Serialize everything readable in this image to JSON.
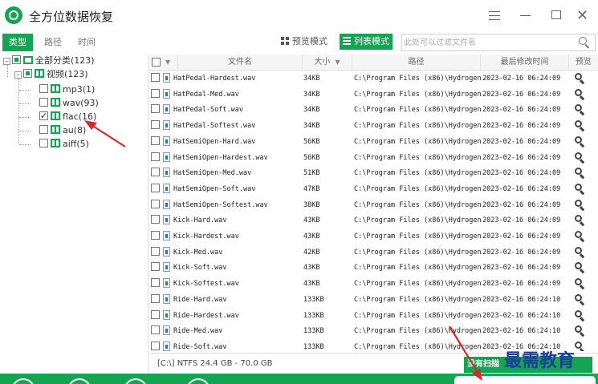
{
  "app": {
    "title": "全方位数据恢复"
  },
  "tabs": [
    {
      "label": "类型",
      "active": true
    },
    {
      "label": "路径",
      "active": false
    },
    {
      "label": "时间",
      "active": false
    }
  ],
  "view": {
    "preview_label": "预览模式",
    "list_label": "列表模式"
  },
  "search": {
    "placeholder": "此处可以过滤文件名"
  },
  "tree": {
    "root": "全部分类(123)",
    "child": "视频(123)",
    "items": [
      {
        "label": "mp3(1)",
        "checked": false
      },
      {
        "label": "wav(93)",
        "checked": false
      },
      {
        "label": "flac(16)",
        "checked": true
      },
      {
        "label": "au(8)",
        "checked": false
      },
      {
        "label": "aiff(5)",
        "checked": false
      }
    ]
  },
  "table": {
    "headers": {
      "name": "文件名",
      "size": "大小",
      "path": "路径",
      "modified": "最后修改时间",
      "preview": "预览"
    },
    "rows": [
      {
        "name": "HatPedal-Hardest.wav",
        "size": "34KB",
        "path": "C:\\Program Files (x86)\\Hydrogen",
        "date": "2023-02-16 06:24:09"
      },
      {
        "name": "HatPedal-Med.wav",
        "size": "34KB",
        "path": "C:\\Program Files (x86)\\Hydrogen",
        "date": "2023-02-16 06:24:09"
      },
      {
        "name": "HatPedal-Soft.wav",
        "size": "34KB",
        "path": "C:\\Program Files (x86)\\Hydrogen",
        "date": "2023-02-16 06:24:09"
      },
      {
        "name": "HatPedal-Softest.wav",
        "size": "34KB",
        "path": "C:\\Program Files (x86)\\Hydrogen",
        "date": "2023-02-16 06:24:09"
      },
      {
        "name": "HatSemiOpen-Hard.wav",
        "size": "56KB",
        "path": "C:\\Program Files (x86)\\Hydrogen",
        "date": "2023-02-16 06:24:09"
      },
      {
        "name": "HatSemiOpen-Hardest.wav",
        "size": "56KB",
        "path": "C:\\Program Files (x86)\\Hydrogen",
        "date": "2023-02-16 06:24:09"
      },
      {
        "name": "HatSemiOpen-Med.wav",
        "size": "51KB",
        "path": "C:\\Program Files (x86)\\Hydrogen",
        "date": "2023-02-16 06:24:09"
      },
      {
        "name": "HatSemiOpen-Soft.wav",
        "size": "47KB",
        "path": "C:\\Program Files (x86)\\Hydrogen",
        "date": "2023-02-16 06:24:09"
      },
      {
        "name": "HatSemiOpen-Softest.wav",
        "size": "38KB",
        "path": "C:\\Program Files (x86)\\Hydrogen",
        "date": "2023-02-16 06:24:09"
      },
      {
        "name": "Kick-Hard.wav",
        "size": "43KB",
        "path": "C:\\Program Files (x86)\\Hydrogen",
        "date": "2023-02-16 06:24:09"
      },
      {
        "name": "Kick-Hardest.wav",
        "size": "43KB",
        "path": "C:\\Program Files (x86)\\Hydrogen",
        "date": "2023-02-16 06:24:09"
      },
      {
        "name": "Kick-Med.wav",
        "size": "42KB",
        "path": "C:\\Program Files (x86)\\Hydrogen",
        "date": "2023-02-16 06:24:09"
      },
      {
        "name": "Kick-Soft.wav",
        "size": "43KB",
        "path": "C:\\Program Files (x86)\\Hydrogen",
        "date": "2023-02-16 06:24:09"
      },
      {
        "name": "Kick-Softest.wav",
        "size": "43KB",
        "path": "C:\\Program Files (x86)\\Hydrogen",
        "date": "2023-02-16 06:24:09"
      },
      {
        "name": "Ride-Hard.wav",
        "size": "133KB",
        "path": "C:\\Program Files (x86)\\Hydrogen",
        "date": "2023-02-16 06:24:10"
      },
      {
        "name": "Ride-Hardest.wav",
        "size": "133KB",
        "path": "C:\\Program Files (x86)\\Hydrogen",
        "date": "2023-02-16 06:24:10"
      },
      {
        "name": "Ride-Med.wav",
        "size": "133KB",
        "path": "C:\\Program Files (x86)\\Hydrogen",
        "date": "2023-02-16 06:24:10"
      },
      {
        "name": "Ride-Soft.wav",
        "size": "133KB",
        "path": "C:\\Program Files (x86)\\Hydrogen",
        "date": "2023-02-16 06:24:10"
      }
    ]
  },
  "status": {
    "drive": "[C:\\] NTFS 24.4 GB - 70.0 GB",
    "scan_button": "没有扫描"
  },
  "watermark": "最需教育",
  "colors": {
    "brand": "#15a552",
    "annotation_arrow": "#d62b2b"
  }
}
